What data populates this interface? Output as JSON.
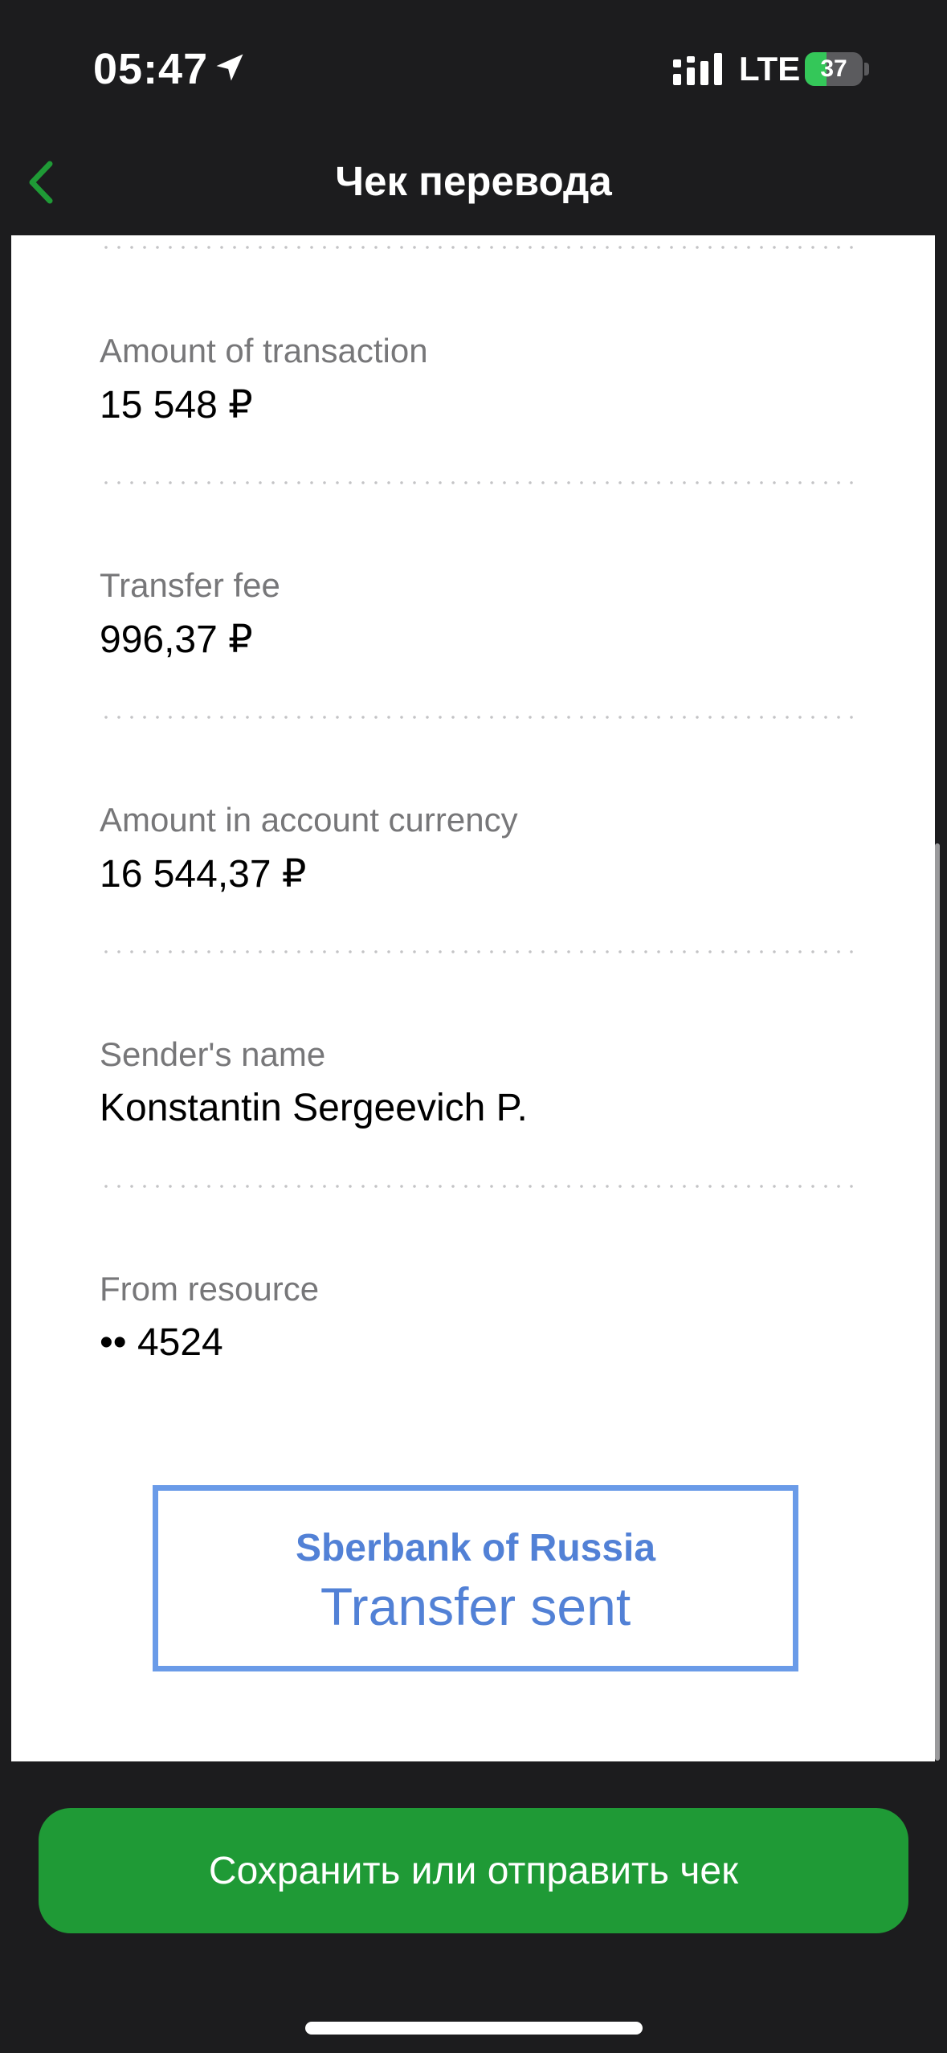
{
  "status_bar": {
    "time": "05:47",
    "network": "LTE",
    "battery_percent": 37,
    "battery_label": "37",
    "location_icon": "location-arrow-icon",
    "signal_icon": "cellular-signal-icon"
  },
  "header": {
    "title": "Чек перевода",
    "back_icon": "chevron-left-icon"
  },
  "receipt": {
    "fields": [
      {
        "label": "Amount of transaction",
        "value": "15 548 ₽"
      },
      {
        "label": "Transfer fee",
        "value": "996,37 ₽"
      },
      {
        "label": "Amount in account currency",
        "value": "16 544,37 ₽"
      },
      {
        "label": "Sender's name",
        "value": "Konstantin Sergeevich P."
      },
      {
        "label": "From resource",
        "value": "•• 4524"
      }
    ],
    "stamp": {
      "bank": "Sberbank of Russia",
      "status": "Transfer sent"
    }
  },
  "actions": {
    "save_label": "Сохранить или отправить чек"
  },
  "colors": {
    "background": "#1c1c1e",
    "accent_green": "#1f9a36",
    "stamp_blue": "#5281d6"
  }
}
